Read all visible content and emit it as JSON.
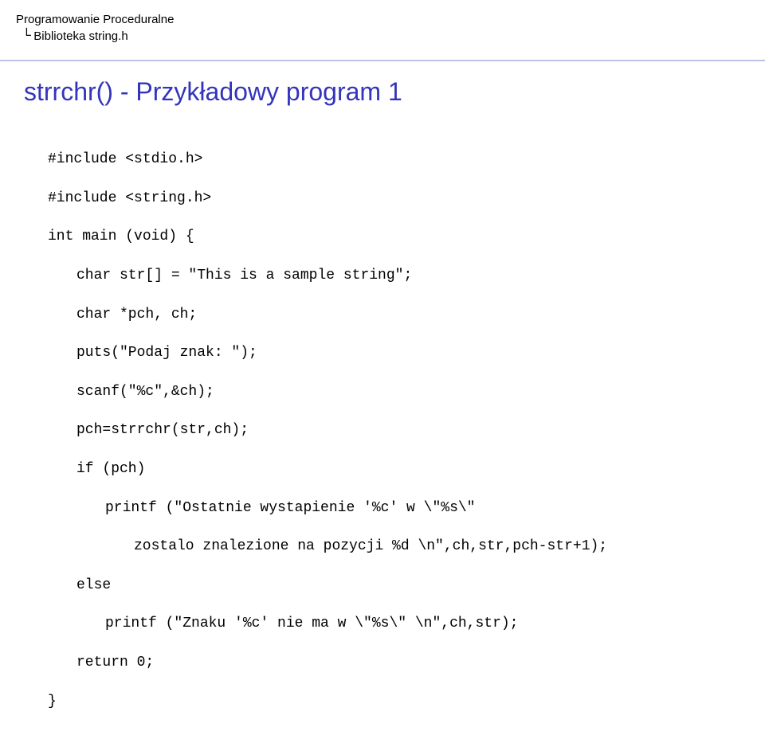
{
  "breadcrumb": {
    "top": "Programowanie Proceduralne",
    "sub": "Biblioteka string.h"
  },
  "title": "strrchr() - Przykładowy program 1",
  "code": {
    "l0": "#include <stdio.h>",
    "l1": "#include <string.h>",
    "l2": "int main (void) {",
    "l3": "char str[] = \"This is a sample string\";",
    "l4": "char *pch, ch;",
    "l5": "puts(\"Podaj znak: \");",
    "l6": "scanf(\"%c\",&ch);",
    "l7": "pch=strrchr(str,ch);",
    "l8": "if (pch)",
    "l9": "printf (\"Ostatnie wystapienie '%c' w \\\"%s\\\"",
    "l10": "zostalo znalezione na pozycji %d \\n\",ch,str,pch-str+1);",
    "l11": "else",
    "l12": "printf (\"Znaku '%c' nie ma w \\\"%s\\\" \\n\",ch,str);",
    "l13": "return 0;",
    "l14": "}"
  }
}
